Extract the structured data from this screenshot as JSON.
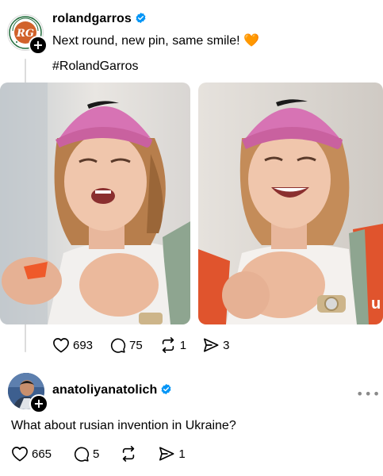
{
  "post1": {
    "username": "rolandgarros",
    "verified": true,
    "text": "Next round, new pin, same smile! 🧡",
    "hashtag": "#RolandGarros",
    "images": [
      "photo-player-holding-pin-1",
      "photo-player-holding-pin-2"
    ],
    "actions": {
      "likes": "693",
      "comments": "75",
      "reposts": "1",
      "shares": "3"
    }
  },
  "post2": {
    "username": "anatoliyanatolich",
    "verified": true,
    "text": "What about rusian invention in Ukraine?",
    "actions": {
      "likes": "665",
      "comments": "5",
      "reposts": "",
      "shares": "1"
    }
  },
  "icons": {
    "follow": "plus-icon",
    "verified": "verified-badge-icon",
    "like": "heart-icon",
    "comment": "comment-icon",
    "repost": "repost-icon",
    "share": "send-icon",
    "more": "more-icon"
  },
  "colors": {
    "verified": "#0095f6",
    "thread_line": "#dcdcdc",
    "cap": "#d773b4",
    "emoji_heart": "#f7931e"
  }
}
